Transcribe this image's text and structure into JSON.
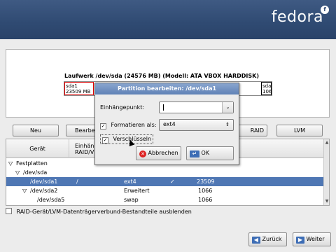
{
  "banner": {
    "logo_text": "fedora",
    "logo_mark": "f"
  },
  "drive": {
    "title": "Laufwerk /dev/sda (24576 MB) (Modell: ATA VBOX HARDDISK)",
    "seg_left_line1": "sda1",
    "seg_left_line2": "23509 MB",
    "seg_right_line1": "sda",
    "seg_right_line2": "106"
  },
  "buttons": {
    "new": "Neu",
    "edit": "Bearbeit",
    "raid": "RAID",
    "lvm": "LVM"
  },
  "tree": {
    "col_device": "Gerät",
    "col_mount_line1": "Einhän",
    "col_mount_line2": "RAID/V",
    "rows": [
      {
        "device": "Festplatten",
        "mount": "",
        "type": "",
        "format": "",
        "size": ""
      },
      {
        "device": "/dev/sda",
        "mount": "",
        "type": "",
        "format": "",
        "size": ""
      },
      {
        "device": "/dev/sda1",
        "mount": "/",
        "type": "ext4",
        "format": "✓",
        "size": "23509"
      },
      {
        "device": "/dev/sda2",
        "mount": "",
        "type": "Erweitert",
        "format": "",
        "size": "1066"
      },
      {
        "device": "/dev/sda5",
        "mount": "",
        "type": "swap",
        "format": "",
        "size": "1066"
      }
    ]
  },
  "hide_option": "RAID-Gerät/LVM-Datenträgerverbund-Bestandteile ausblenden",
  "nav": {
    "back": "Zurück",
    "next": "Weiter"
  },
  "dialog": {
    "title": "Partition bearbeiten: /dev/sda1",
    "mount_label": "Einhängepunkt:",
    "mount_value": "",
    "format_label": "Formatieren als:",
    "format_value": "ext4",
    "encrypt_label": "Verschlüsseln",
    "cancel": "Abbrechen",
    "ok": "OK"
  },
  "colors": {
    "banner": "#2f4a72",
    "selection": "#4f77b4",
    "dialog_title": "#6c8cbf"
  }
}
